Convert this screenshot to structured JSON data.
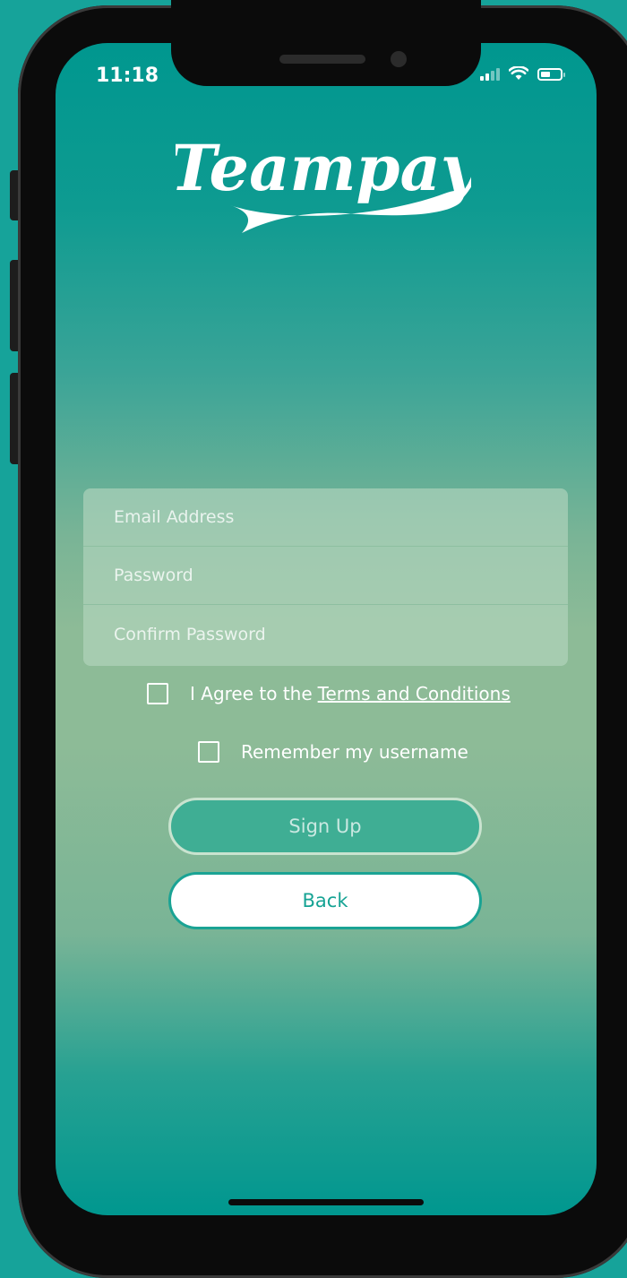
{
  "status_bar": {
    "time": "11:18"
  },
  "brand": {
    "logo_text": "Teampay",
    "accent_color": "#16a394",
    "background_color": "#16a39a"
  },
  "form": {
    "email_placeholder": "Email Address",
    "password_placeholder": "Password",
    "confirm_password_placeholder": "Confirm Password"
  },
  "agree": {
    "prefix": "I Agree to the",
    "link_text": "Terms and Conditions",
    "checked": false
  },
  "remember": {
    "label": "Remember my username",
    "checked": false
  },
  "buttons": {
    "sign_up": "Sign Up",
    "back": "Back"
  }
}
